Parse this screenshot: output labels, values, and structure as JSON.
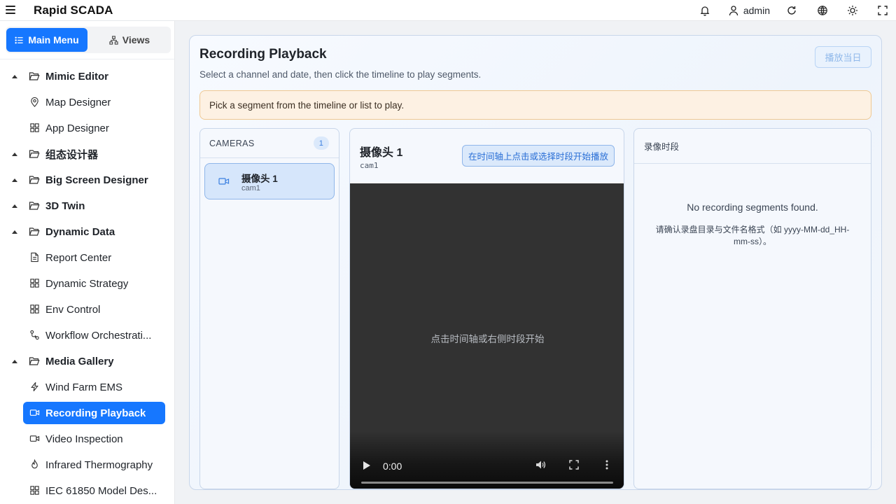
{
  "app": {
    "title": "Rapid SCADA",
    "user": "admin"
  },
  "header_icons": [
    "bell-icon",
    "user-icon",
    "refresh-icon",
    "globe-icon",
    "sun-icon",
    "fullscreen-icon"
  ],
  "sidebar": {
    "tabs": [
      {
        "label": "Main Menu",
        "icon": "list-icon",
        "active": true
      },
      {
        "label": "Views",
        "icon": "sitemap-icon",
        "active": false
      }
    ],
    "items": [
      {
        "label": "Mimic Editor",
        "type": "group",
        "icon": "folder-open-icon"
      },
      {
        "label": "Map Designer",
        "type": "child",
        "icon": "map-pin-icon"
      },
      {
        "label": "App Designer",
        "type": "child",
        "icon": "grid-icon"
      },
      {
        "label": "组态设计器",
        "type": "group",
        "icon": "folder-open-icon"
      },
      {
        "label": "Big Screen Designer",
        "type": "group",
        "icon": "folder-open-icon"
      },
      {
        "label": "3D Twin",
        "type": "group",
        "icon": "folder-open-icon"
      },
      {
        "label": "Dynamic Data",
        "type": "group",
        "icon": "folder-open-icon"
      },
      {
        "label": "Report Center",
        "type": "child",
        "icon": "file-icon"
      },
      {
        "label": "Dynamic Strategy",
        "type": "child",
        "icon": "grid-icon"
      },
      {
        "label": "Env Control",
        "type": "child",
        "icon": "grid-icon"
      },
      {
        "label": "Workflow Orchestrati...",
        "type": "child",
        "icon": "workflow-icon"
      },
      {
        "label": "Media Gallery",
        "type": "group",
        "icon": "folder-open-icon"
      },
      {
        "label": "Wind Farm EMS",
        "type": "child",
        "icon": "lightning-icon"
      },
      {
        "label": "Recording Playback",
        "type": "child",
        "icon": "video-icon",
        "selected": true
      },
      {
        "label": "Video Inspection",
        "type": "child",
        "icon": "video-icon"
      },
      {
        "label": "Infrared Thermography",
        "type": "child",
        "icon": "flame-icon"
      },
      {
        "label": "IEC 61850 Model Des...",
        "type": "child",
        "icon": "grid-icon"
      }
    ]
  },
  "page": {
    "title": "Recording Playback",
    "subtitle": "Select a channel and date, then click the timeline to play segments.",
    "play_today_label": "播放当日",
    "alert": "Pick a segment from the timeline or list to play."
  },
  "cameras": {
    "header": "CAMERAS",
    "count": "1",
    "items": [
      {
        "name": "摄像头 1",
        "id": "cam1"
      }
    ]
  },
  "player": {
    "title": "摄像头 1",
    "channel_id": "cam1",
    "hint_button": "在时间轴上点击或选择时段开始播放",
    "placeholder": "点击时间轴或右侧时段开始",
    "time": "0:00",
    "progress": 0
  },
  "segments": {
    "header": "录像时段",
    "empty": "No recording segments found.",
    "note": "请确认录盘目录与文件名格式（如 yyyy-MM-dd_HH-mm-ss）。"
  },
  "colors": {
    "accent": "#1677ff",
    "alert_bg": "#fdf1e3",
    "alert_border": "#efc892",
    "video_bg": "#323232"
  }
}
